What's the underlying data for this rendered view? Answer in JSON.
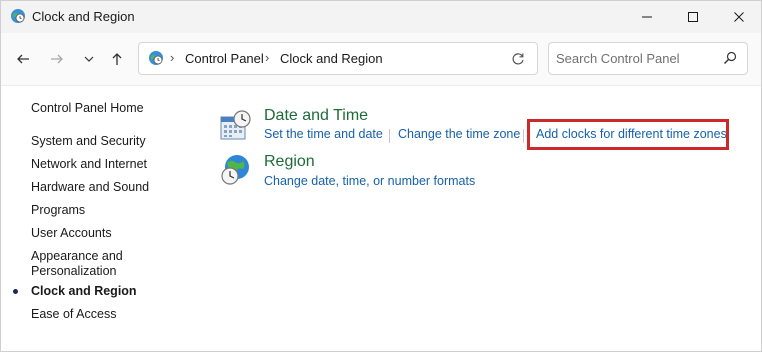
{
  "window": {
    "title": "Clock and Region"
  },
  "address_bar": {
    "crumbs": [
      "Control Panel",
      "Clock and Region"
    ],
    "separator": "›"
  },
  "search": {
    "placeholder": "Search Control Panel"
  },
  "sidebar": {
    "home": "Control Panel Home",
    "items": [
      {
        "label": "System and Security"
      },
      {
        "label": "Network and Internet"
      },
      {
        "label": "Hardware and Sound"
      },
      {
        "label": "Programs"
      },
      {
        "label": "User Accounts"
      },
      {
        "label": "Appearance and",
        "label2": "Personalization"
      },
      {
        "label": "Clock and Region",
        "current": true
      },
      {
        "label": "Ease of Access"
      }
    ]
  },
  "main": {
    "categories": [
      {
        "title": "Date and Time",
        "icon": "date-time-icon",
        "links": [
          "Set the time and date",
          "Change the time zone",
          "Add clocks for different time zones"
        ]
      },
      {
        "title": "Region",
        "icon": "region-globe-icon",
        "links": [
          "Change date, time, or number formats"
        ]
      }
    ]
  },
  "colors": {
    "category_title": "#1e6b3a",
    "link": "#1761ab",
    "highlight_border": "#cc2a2a"
  }
}
